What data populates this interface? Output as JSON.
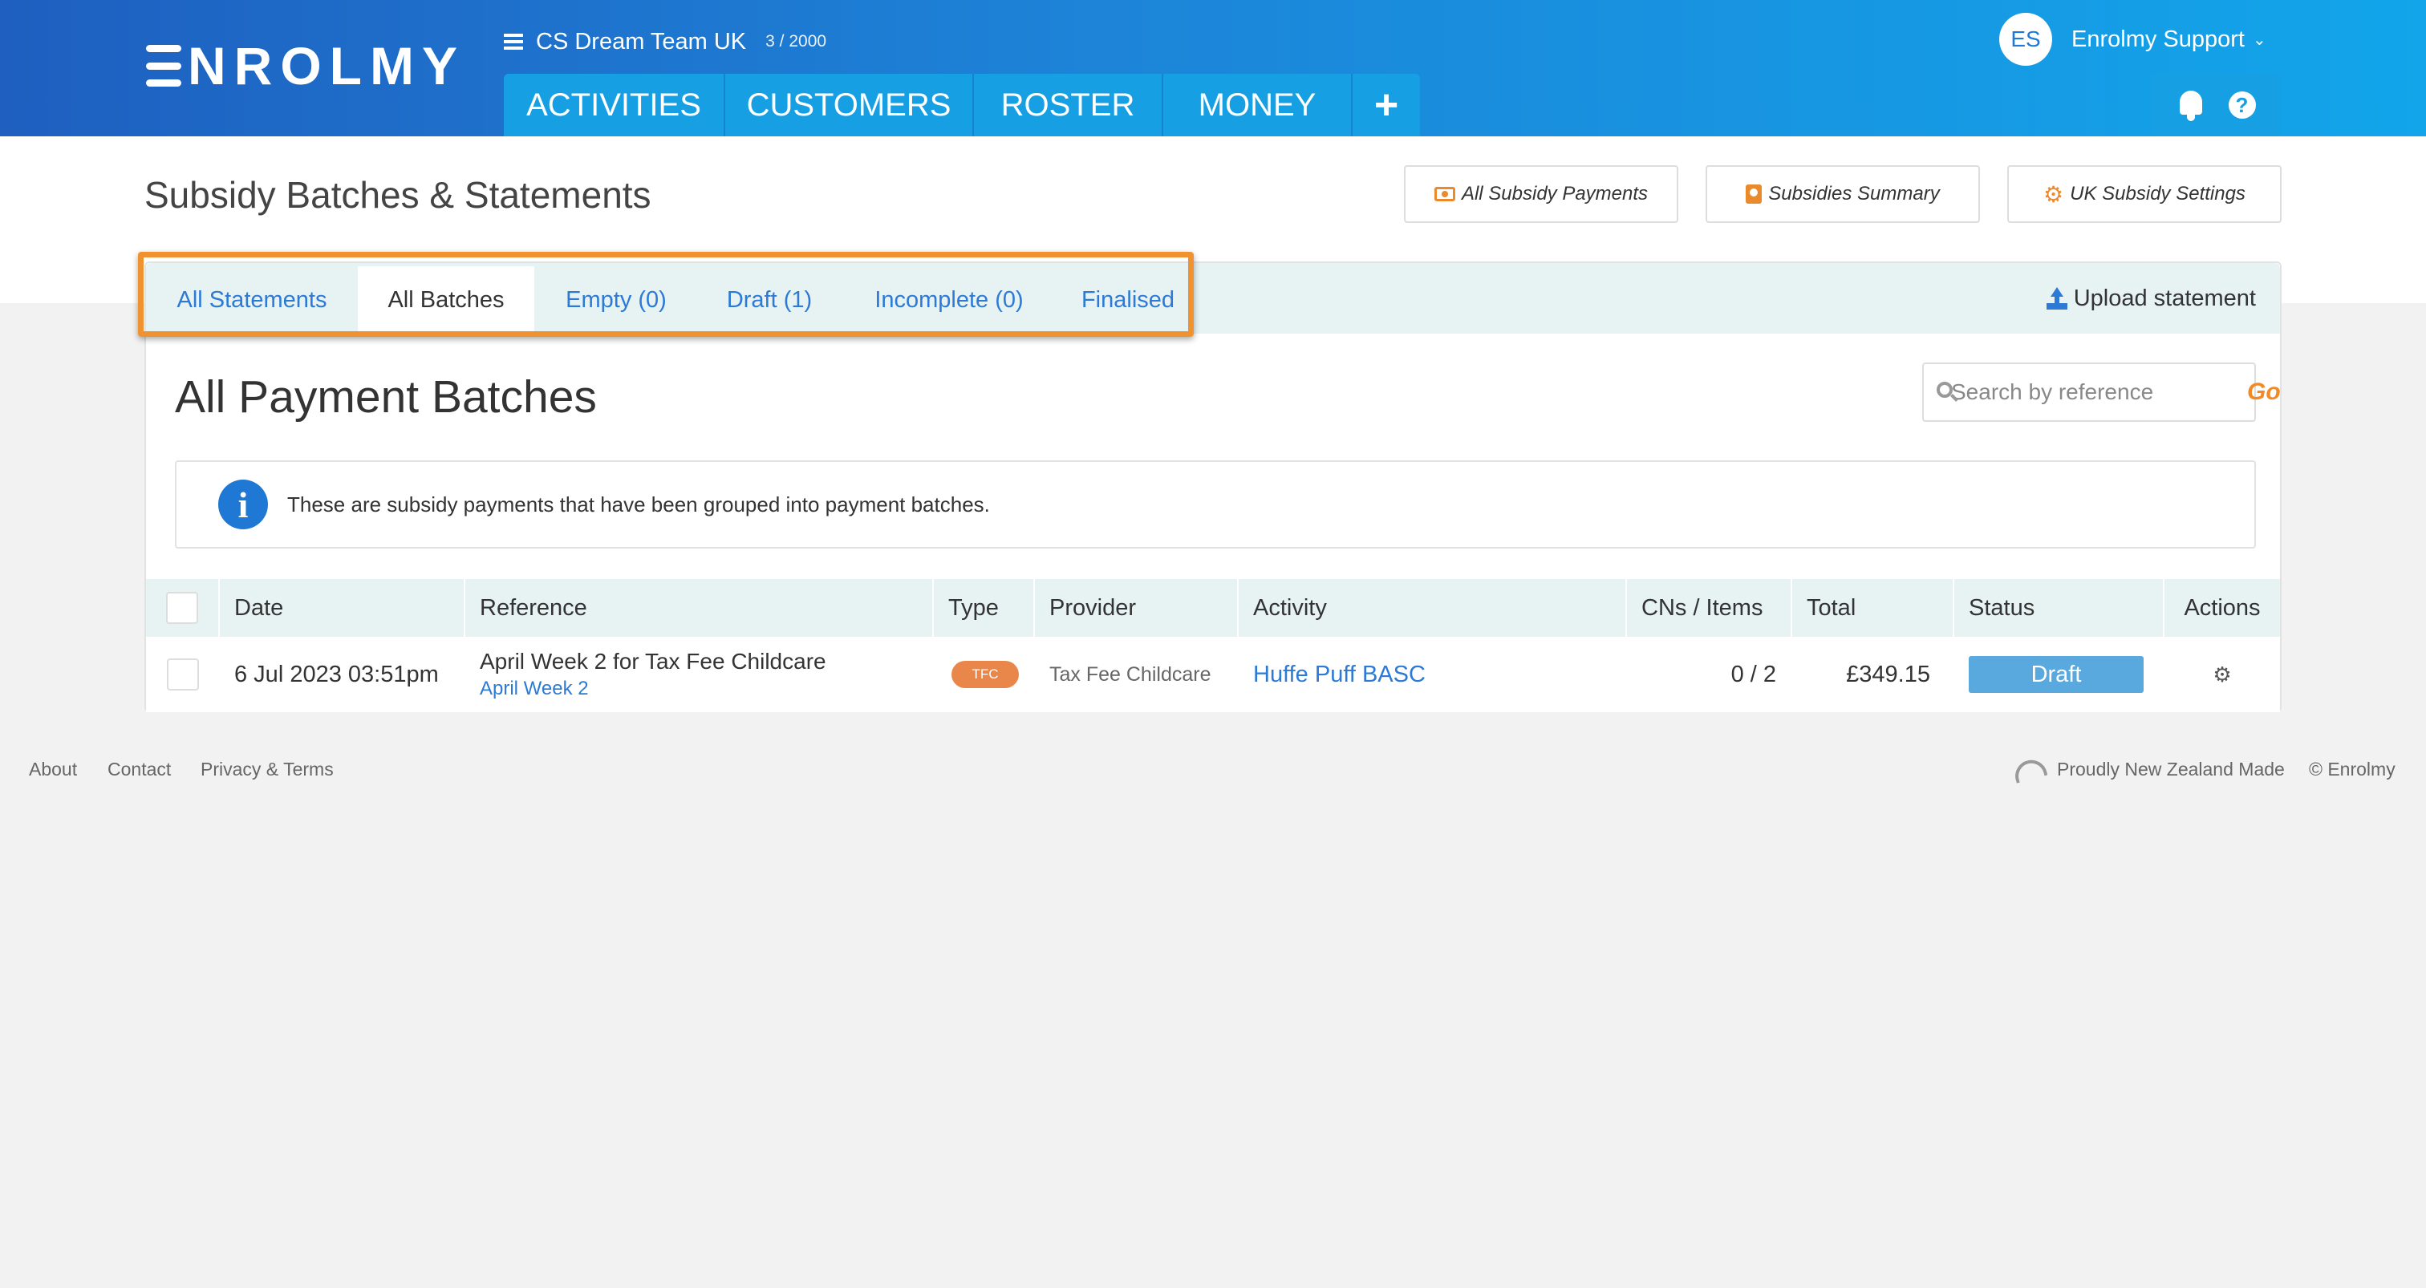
{
  "header": {
    "logo_text": "ENROLMY",
    "org_name": "CS Dream Team UK",
    "org_count": "3 / 2000",
    "nav": [
      "ACTIVITIES",
      "CUSTOMERS",
      "ROSTER",
      "MONEY",
      "+"
    ],
    "user_initials": "ES",
    "user_name": "Enrolmy Support",
    "icons": [
      "menu-icon",
      "bell-icon",
      "help-icon",
      "chevron-down-icon"
    ]
  },
  "page": {
    "title": "Subsidy Batches & Statements",
    "buttons": [
      "All Subsidy Payments",
      "Subsidies Summary",
      "UK Subsidy Settings"
    ]
  },
  "subtabs": {
    "items": [
      "All Statements",
      "All Batches",
      "Empty (0)",
      "Draft (1)",
      "Incomplete (0)",
      "Finalised"
    ],
    "active": "All Batches",
    "upload_label": "Upload statement"
  },
  "main": {
    "title": "All Payment Batches",
    "search_placeholder": "Search by reference",
    "search_go": "Go",
    "info_text": "These are subsidy payments that have been grouped into payment batches."
  },
  "table": {
    "headers": [
      "Date",
      "Reference",
      "Type",
      "Provider",
      "Activity",
      "CNs / Items",
      "Total",
      "Status",
      "Actions"
    ],
    "rows": [
      {
        "date": "6 Jul 2023 03:51pm",
        "reference": "April Week 2 for Tax Fee Childcare",
        "reference_link": "April Week 2",
        "type": "TFC",
        "provider": "Tax Fee Childcare",
        "activity": "Huffe Puff BASC",
        "cns_items": "0 / 2",
        "total": "£349.15",
        "status": "Draft"
      }
    ]
  },
  "footer": {
    "links": [
      "About",
      "Contact",
      "Privacy & Terms"
    ],
    "made": "Proudly New Zealand Made",
    "copyright": "© Enrolmy"
  },
  "colors": {
    "header_gradient_start": "#1e5fc0",
    "header_gradient_end": "#12a5ea",
    "nav_tab": "#179fe3",
    "link_blue": "#2c7ad6",
    "accent_orange": "#f09230",
    "status_draft": "#5aa9de",
    "type_badge": "#e9864a"
  }
}
